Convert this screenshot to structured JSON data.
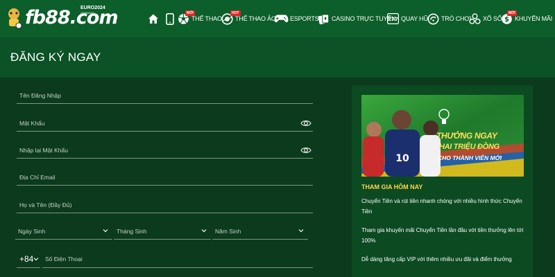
{
  "brand": {
    "name": "fb88.com",
    "event": "EURO2024",
    "event_sub": "GERMANY"
  },
  "nav": {
    "items": [
      {
        "label": "THỂ THAO",
        "icon": "soccer-ball-icon",
        "badge": "MỚI"
      },
      {
        "label": "THỂ THAO ẢO",
        "icon": "virtual-sports-icon",
        "badge": "HOT"
      },
      {
        "label": "ESPORTS",
        "icon": "gamepad-icon"
      },
      {
        "label": "CASINO TRỰC TUYẾN",
        "icon": "cards-icon"
      },
      {
        "label": "QUAY HŨ",
        "icon": "slot-777-icon"
      },
      {
        "label": "TRÒ CHƠI",
        "icon": "game-icon"
      },
      {
        "label": "XỔ SỐ",
        "icon": "lottery-icon"
      },
      {
        "label": "KHUYẾN MÃI",
        "icon": "promotion-icon",
        "badge": "MỚI"
      }
    ]
  },
  "page_title": "ĐĂNG KÝ NGAY",
  "form": {
    "username": "Tên Đăng Nhập",
    "password": "Mật Khẩu",
    "confirm_password": "Nhập lại Mật Khẩu",
    "email": "Địa Chỉ Email",
    "fullname": "Họ và Tên (Đầy Đủ)",
    "birth_day": "Ngày Sinh",
    "birth_month": "Tháng Sinh",
    "birth_year": "Năm Sinh",
    "country_code": "+84",
    "phone": "Số Điện Thoại"
  },
  "promo": {
    "banner_line1": "THƯỞNG NGAY",
    "banner_line2": "HAI TRIỆU ĐỒNG",
    "banner_line3": "CHO THÀNH VIÊN MỚI",
    "heading": "THAM GIA HÔM NAY",
    "points": [
      "Chuyển Tiền và rút tiền nhanh chóng với nhiều hình thức Chuyển Tiền",
      "Tham gia khuyến mãi Chuyển Tiền lần đầu với tiền thưởng lên tới 100%",
      "Dễ dàng tăng cấp VIP với thêm nhiều ưu đãi và điểm thưởng"
    ]
  },
  "colors": {
    "header": "#0c5e2a",
    "title_bar": "#0b5226",
    "background": "#0b3a1c",
    "panel": "#0c4a22",
    "accent_yellow": "#ffd84a",
    "badge_red": "#e02525"
  }
}
